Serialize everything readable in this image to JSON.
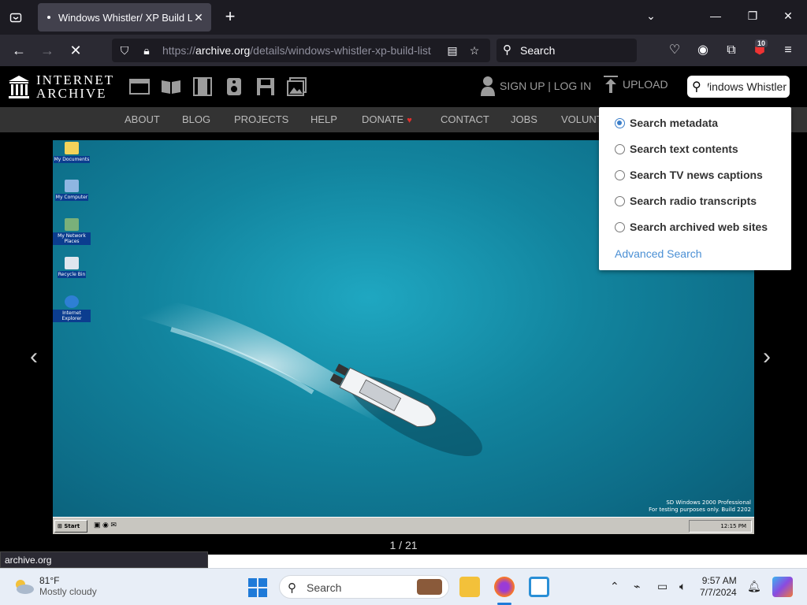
{
  "browser": {
    "tab_title": "Windows Whistler/ XP Build List",
    "new_tab": "+",
    "tab_close": "✕",
    "url_prefix": "https://",
    "url_domain": "archive.org",
    "url_path": "/details/windows-whistler-xp-build-list",
    "search_placeholder": "Search",
    "extension_badge": "10",
    "status_text": "archive.org"
  },
  "ia": {
    "logo_line1": "INTERNET",
    "logo_line2": "ARCHIVE",
    "signup": "SIGN UP | LOG IN",
    "upload": "UPLOAD",
    "search_value": "Windows Whistler",
    "nav": [
      "ABOUT",
      "BLOG",
      "PROJECTS",
      "HELP",
      "DONATE",
      "CONTACT",
      "JOBS",
      "VOLUNT"
    ]
  },
  "dropdown": {
    "options": [
      {
        "label": "Search metadata",
        "selected": true
      },
      {
        "label": "Search text contents",
        "selected": false
      },
      {
        "label": "Search TV news captions",
        "selected": false
      },
      {
        "label": "Search radio transcripts",
        "selected": false
      },
      {
        "label": "Search archived web sites",
        "selected": false
      }
    ],
    "advanced": "Advanced Search"
  },
  "viewer": {
    "counter": "1 / 21",
    "prev": "‹",
    "next": "›",
    "desktop_icons": [
      "My Documents",
      "My Computer",
      "My Network Places",
      "Recycle Bin",
      "Internet Explorer"
    ],
    "watermark_line1": "SD Windows 2000 Professional",
    "watermark_line2": "For testing purposes only. Build 2202",
    "start_label": "Start",
    "tray_time": "12:15 PM"
  },
  "taskbar": {
    "temp": "81°F",
    "condition": "Mostly cloudy",
    "search_placeholder": "Search",
    "time": "9:57 AM",
    "date": "7/7/2024"
  }
}
